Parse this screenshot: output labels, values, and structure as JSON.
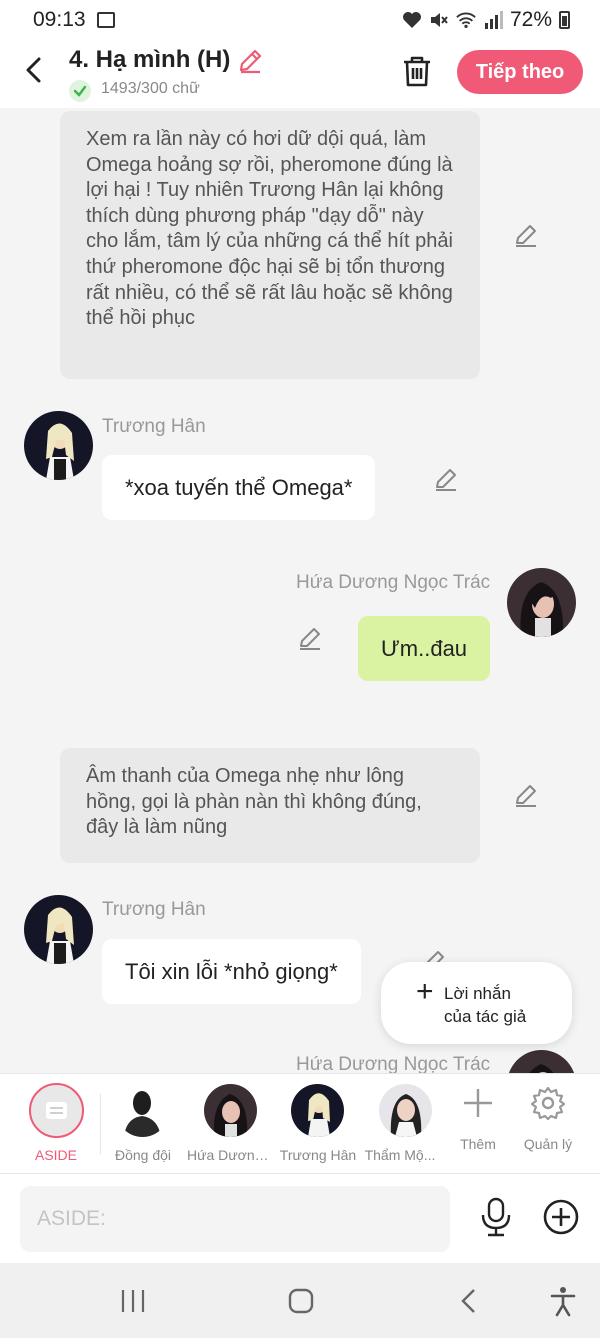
{
  "status_bar": {
    "time": "09:13",
    "battery": "72%"
  },
  "header": {
    "title": "4. Hạ mình (H)",
    "word_count": "1493/300 chữ",
    "next_label": "Tiếp theo"
  },
  "messages": [
    {
      "type": "narration",
      "text": "Xem ra lần này có hơi dữ dội quá, làm Omega hoảng sợ rồi, pheromone đúng là lợi hại ! Tuy nhiên Trương Hân lại không thích dùng phương pháp \"dạy dỗ\" này cho lắm, tâm lý của những cá thể hít phải thứ pheromone độc hại sẽ bị tổn thương rất nhiều, có thể sẽ rất lâu hoặc sẽ không thể hồi phục"
    },
    {
      "type": "left",
      "name": "Trương Hân",
      "text": "*xoa tuyến thể Omega*"
    },
    {
      "type": "right",
      "name": "Hứa Dương Ngọc Trác",
      "text": "Ưm..đau"
    },
    {
      "type": "narration",
      "text": "Âm thanh của Omega nhẹ như lông hồng, gọi là phàn nàn thì không đúng, đây là làm nũng"
    },
    {
      "type": "left",
      "name": "Trương Hân",
      "text": "Tôi xin lỗi *nhỏ giọng*"
    },
    {
      "type": "right",
      "name": "Hứa Dương Ngọc Trác",
      "text": ""
    }
  ],
  "author_note": {
    "line1": "Lời nhắn",
    "line2": "của tác giả"
  },
  "character_bar": {
    "items": [
      {
        "label": "ASIDE"
      },
      {
        "label": "Đồng đội"
      },
      {
        "label": "Hứa Dương Ngọc Trác"
      },
      {
        "label": "Trương Hân"
      },
      {
        "label": "Thẩm Mộ..."
      },
      {
        "label": "Thêm"
      },
      {
        "label": "Quản lý"
      }
    ]
  },
  "composer": {
    "placeholder": "ASIDE:"
  },
  "colors": {
    "accent": "#f05a76",
    "my_bubble": "#d9f3a2",
    "narration_bg": "#e9e9e9"
  }
}
